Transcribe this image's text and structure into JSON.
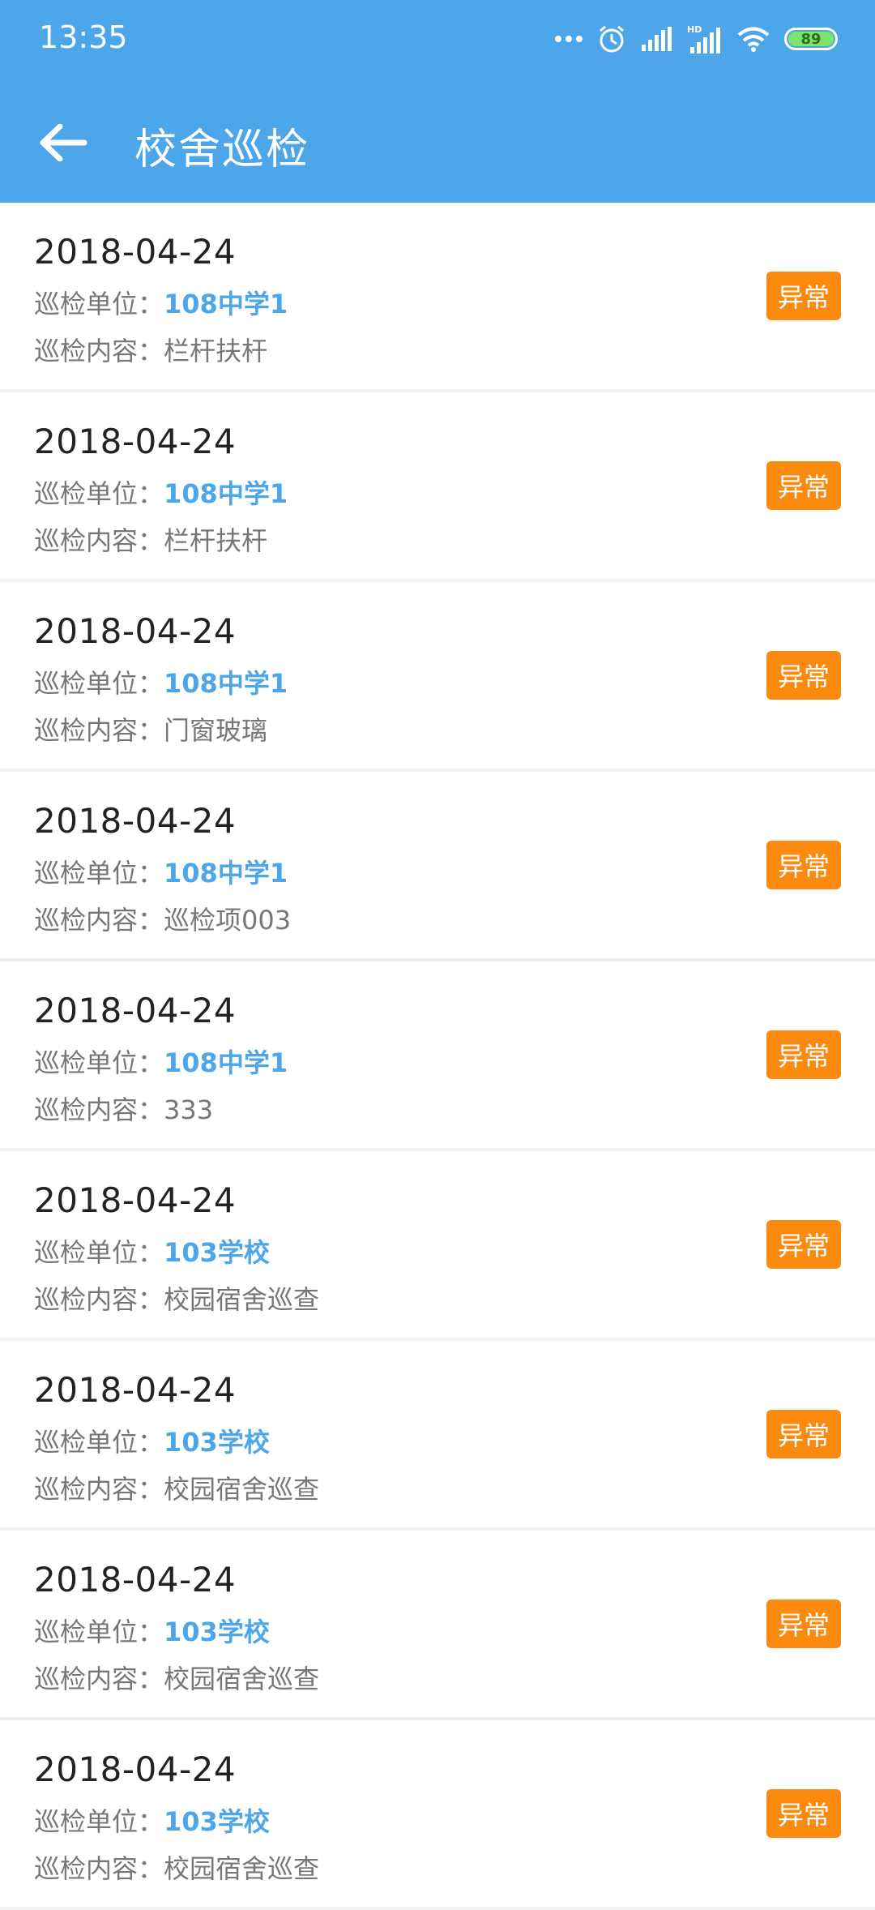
{
  "status_bar": {
    "time": "13:35",
    "battery": "89",
    "icons": [
      "more-dots-icon",
      "alarm-icon",
      "signal-icon",
      "hd-signal-icon",
      "wifi-icon",
      "battery-icon"
    ]
  },
  "app_bar": {
    "back_icon": "arrow-left-icon",
    "title": "校舍巡检"
  },
  "colors": {
    "primary": "#4da6ea",
    "badge": "#fb8a0e"
  },
  "labels": {
    "unit": "巡检单位：",
    "content": "巡检内容："
  },
  "items": [
    {
      "date": "2018-04-24",
      "unit": "108中学1",
      "content": "栏杆扶杆",
      "status": "异常"
    },
    {
      "date": "2018-04-24",
      "unit": "108中学1",
      "content": "栏杆扶杆",
      "status": "异常"
    },
    {
      "date": "2018-04-24",
      "unit": "108中学1",
      "content": "门窗玻璃",
      "status": "异常"
    },
    {
      "date": "2018-04-24",
      "unit": "108中学1",
      "content": "巡检项003",
      "status": "异常"
    },
    {
      "date": "2018-04-24",
      "unit": "108中学1",
      "content": "333",
      "status": "异常"
    },
    {
      "date": "2018-04-24",
      "unit": "103学校",
      "content": "校园宿舍巡查",
      "status": "异常"
    },
    {
      "date": "2018-04-24",
      "unit": "103学校",
      "content": "校园宿舍巡查",
      "status": "异常"
    },
    {
      "date": "2018-04-24",
      "unit": "103学校",
      "content": "校园宿舍巡查",
      "status": "异常"
    },
    {
      "date": "2018-04-24",
      "unit": "103学校",
      "content": "校园宿舍巡查",
      "status": "异常"
    }
  ]
}
